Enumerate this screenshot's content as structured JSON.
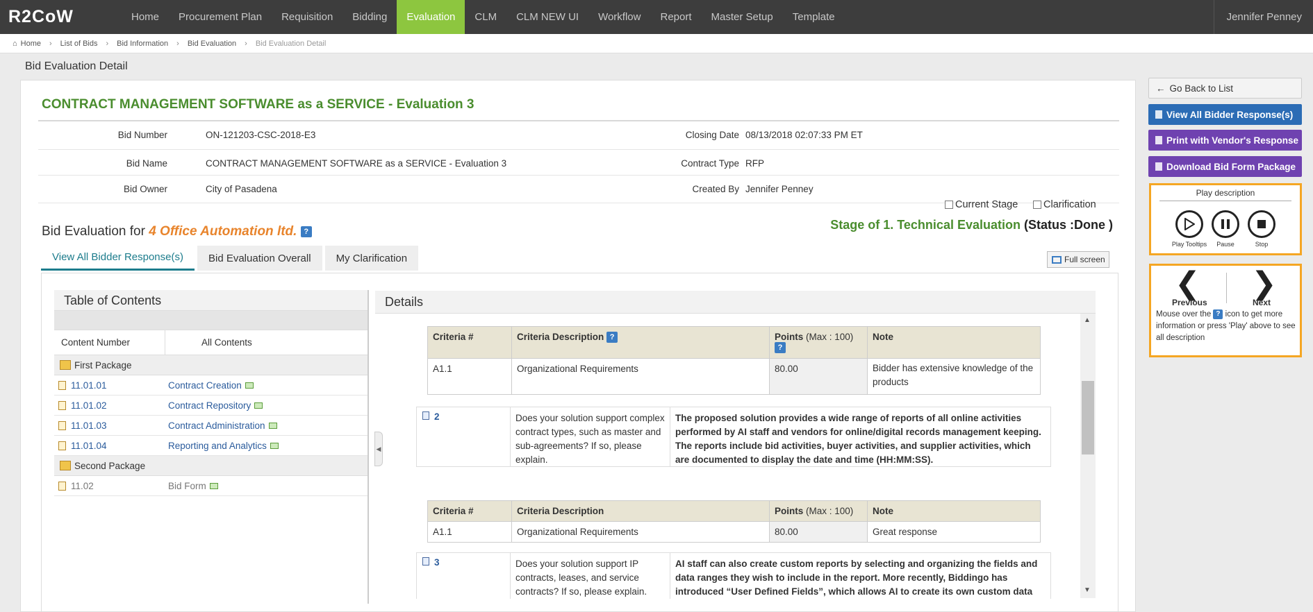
{
  "nav": {
    "logo": "R2CoW",
    "items": [
      "Home",
      "Procurement Plan",
      "Requisition",
      "Bidding",
      "Evaluation",
      "CLM",
      "CLM NEW UI",
      "Workflow",
      "Report",
      "Master Setup",
      "Template"
    ],
    "active": "Evaluation",
    "user": "Jennifer Penney"
  },
  "breadcrumb": [
    "Home",
    "List of Bids",
    "Bid Information",
    "Bid Evaluation",
    "Bid Evaluation Detail"
  ],
  "page_title": "Bid Evaluation Detail",
  "bid": {
    "title": "CONTRACT MANAGEMENT SOFTWARE as a SERVICE - Evaluation 3",
    "bid_number_label": "Bid Number",
    "bid_number": "ON-121203-CSC-2018-E3",
    "bid_name_label": "Bid Name",
    "bid_name": "CONTRACT MANAGEMENT SOFTWARE as a SERVICE - Evaluation 3",
    "bid_owner_label": "Bid Owner",
    "bid_owner": "City of Pasadena",
    "closing_date_label": "Closing Date",
    "closing_date": "08/13/2018 02:07:33 PM ET",
    "contract_type_label": "Contract Type",
    "contract_type": "RFP",
    "created_by_label": "Created By",
    "created_by": "Jennifer Penney"
  },
  "evaluation": {
    "for_label": "Bid Evaluation for",
    "vendor": "4 Office Automation ltd.",
    "help": "?",
    "stage": "Stage of 1. Technical Evaluation",
    "status": "(Status :Done )"
  },
  "tabs": [
    "View All Bidder Response(s)",
    "Bid Evaluation Overall",
    "My Clarification"
  ],
  "fullscreen_label": "Full screen",
  "filters": {
    "current_stage": "Current Stage",
    "clarification": "Clarification"
  },
  "toc": {
    "title": "Table of Contents",
    "col_number": "Content Number",
    "col_contents": "All Contents",
    "packages": [
      {
        "name": "First Package",
        "items": [
          {
            "num": "11.01.01",
            "name": "Contract Creation"
          },
          {
            "num": "11.01.02",
            "name": "Contract Repository"
          },
          {
            "num": "11.01.03",
            "name": "Contract Administration"
          },
          {
            "num": "11.01.04",
            "name": "Reporting and Analytics"
          }
        ]
      },
      {
        "name": "Second Package",
        "items": [
          {
            "num": "11.02",
            "name": "Bid Form"
          }
        ]
      }
    ]
  },
  "details": {
    "title": "Details",
    "crit_headers": {
      "num": "Criteria #",
      "desc": "Criteria Description",
      "points": "Points",
      "points_max": "(Max : 100)",
      "note": "Note"
    },
    "criteria": [
      {
        "num": "A1.1",
        "desc": "Organizational Requirements",
        "points": "80.00",
        "note": "Bidder has extensive knowledge of the products"
      },
      {
        "num": "A1.1",
        "desc": "Organizational Requirements",
        "points": "80.00",
        "note": "Great response"
      }
    ],
    "questions": [
      {
        "num": "2",
        "question": "Does your solution support complex contract types, such as master and sub-agreements? If so, please explain.",
        "answer": "The proposed solution provides a wide range of reports of all online activities performed by AI staff and vendors for online/digital records management keeping. The reports include bid activities, buyer activities, and supplier activities, which are documented to display the date and time (HH:MM:SS)."
      },
      {
        "num": "3",
        "question": "Does your solution support IP contracts, leases, and service contracts? If so, please explain.",
        "answer": "AI staff can also create custom reports by selecting and organizing the fields and data ranges they wish to include in the report. More recently, Biddingo has introduced “User Defined Fields”, which allows AI to create its own custom data fields (metadata)"
      }
    ]
  },
  "sidebar": {
    "back": "Go Back to List",
    "view_all": "View All Bidder Response(s)",
    "print": "Print with Vendor's Response",
    "download": "Download Bid Form Package",
    "play_title": "Play description",
    "play": "Play Tooltips",
    "pause": "Pause",
    "stop": "Stop",
    "previous": "Previous",
    "next": "Next",
    "desc_pre": "Mouse over the",
    "desc_post": "icon to get more information or press 'Play' above to see all description"
  }
}
